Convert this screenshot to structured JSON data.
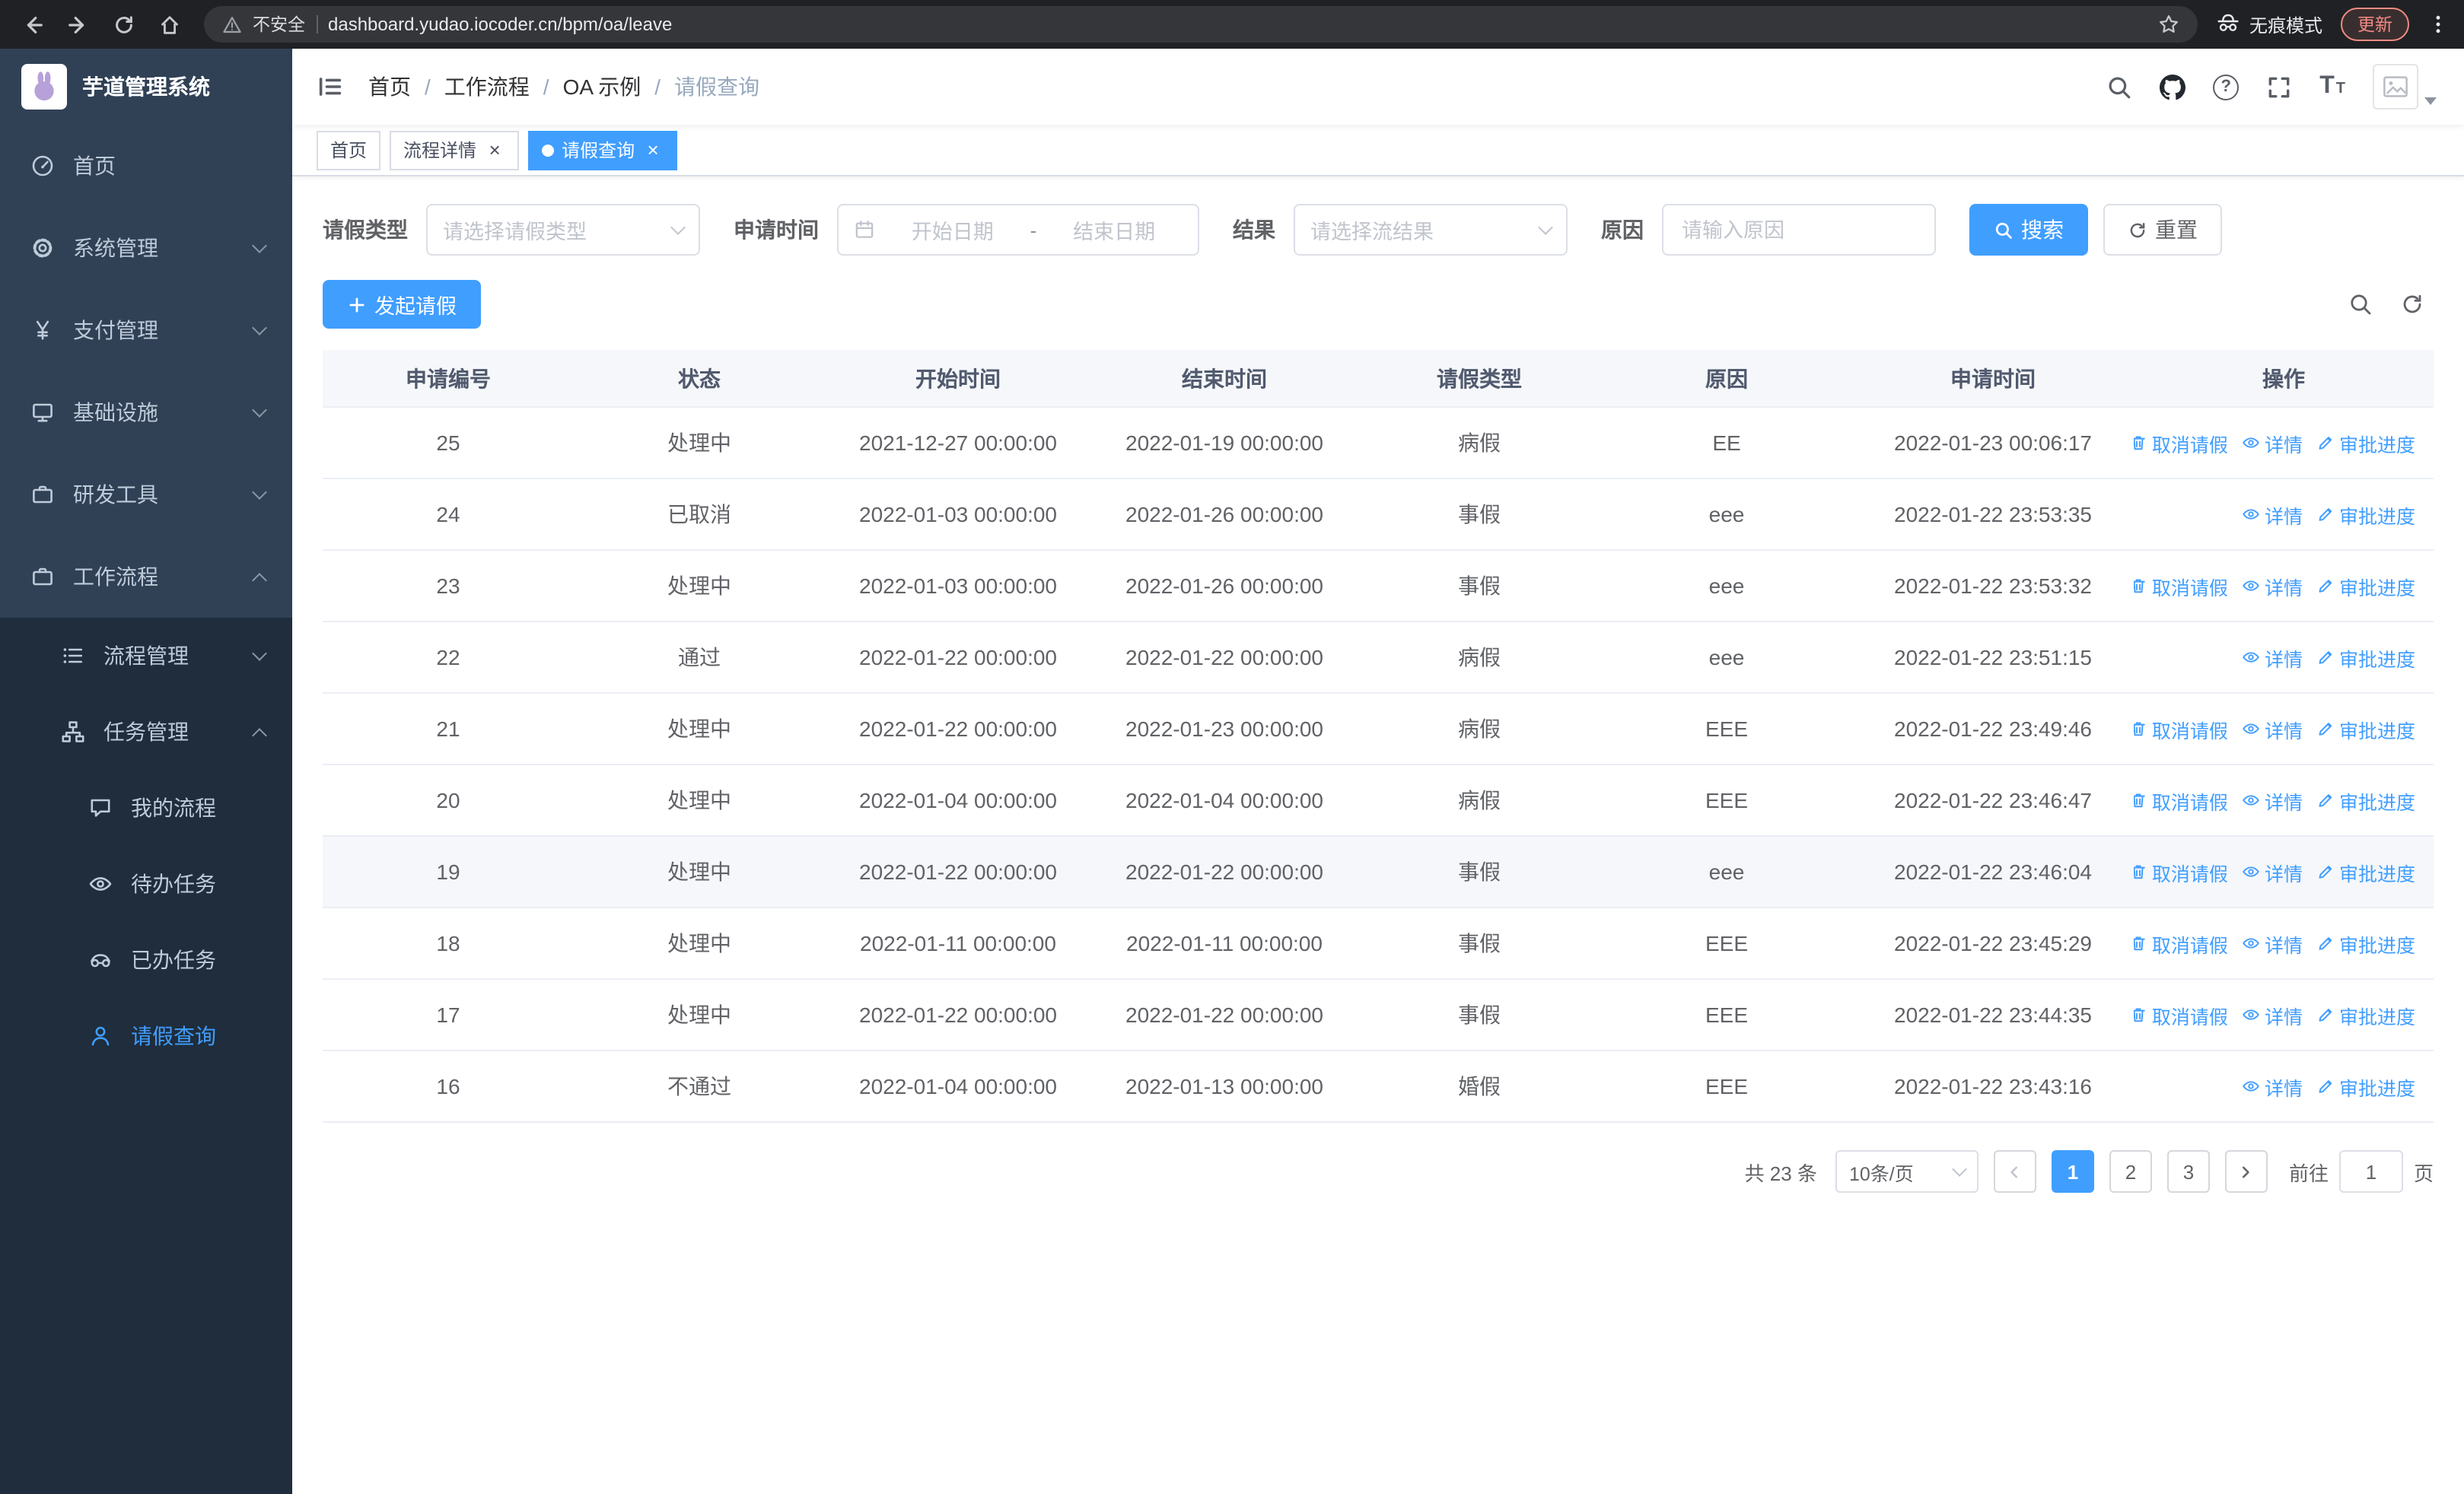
{
  "browser": {
    "security_label": "不安全",
    "url": "dashboard.yudao.iocoder.cn/bpm/oa/leave",
    "incognito_label": "无痕模式",
    "update_label": "更新"
  },
  "sidebar": {
    "app_title": "芋道管理系统",
    "items": [
      {
        "name": "home",
        "label": "首页",
        "icon": "gauge-icon",
        "level": 1
      },
      {
        "name": "system-management",
        "label": "系统管理",
        "icon": "gear-icon",
        "level": 1,
        "chevron": "down"
      },
      {
        "name": "payment-management",
        "label": "支付管理",
        "icon": "yen-icon",
        "level": 1,
        "chevron": "down"
      },
      {
        "name": "infrastructure",
        "label": "基础设施",
        "icon": "monitor-icon",
        "level": 1,
        "chevron": "down"
      },
      {
        "name": "dev-tools",
        "label": "研发工具",
        "icon": "briefcase-icon",
        "level": 1,
        "chevron": "down"
      },
      {
        "name": "workflow",
        "label": "工作流程",
        "icon": "briefcase-icon",
        "level": 1,
        "chevron": "up"
      },
      {
        "name": "process-management",
        "label": "流程管理",
        "icon": "list-icon",
        "level": 2,
        "chevron": "down"
      },
      {
        "name": "task-management",
        "label": "任务管理",
        "icon": "sitemap-icon",
        "level": 2,
        "chevron": "up"
      },
      {
        "name": "my-processes",
        "label": "我的流程",
        "icon": "chat-icon",
        "level": 3
      },
      {
        "name": "todo-tasks",
        "label": "待办任务",
        "icon": "eye-icon",
        "level": 3
      },
      {
        "name": "done-tasks",
        "label": "已办任务",
        "icon": "glasses-icon",
        "level": 3
      },
      {
        "name": "leave-query",
        "label": "请假查询",
        "icon": "user-icon",
        "level": 3,
        "active": true
      }
    ]
  },
  "navbar": {
    "breadcrumbs": [
      "首页",
      "工作流程",
      "OA 示例",
      "请假查询"
    ],
    "separator": "/"
  },
  "tags": [
    {
      "label": "首页",
      "closable": false,
      "active": false
    },
    {
      "label": "流程详情",
      "closable": true,
      "active": false
    },
    {
      "label": "请假查询",
      "closable": true,
      "active": true
    }
  ],
  "filters": {
    "leave_type_label": "请假类型",
    "leave_type_placeholder": "请选择请假类型",
    "apply_time_label": "申请时间",
    "start_placeholder": "开始日期",
    "range_separator": "-",
    "end_placeholder": "结束日期",
    "result_label": "结果",
    "result_placeholder": "请选择流结果",
    "reason_label": "原因",
    "reason_placeholder": "请输入原因",
    "search_label": "搜索",
    "reset_label": "重置"
  },
  "toolbar": {
    "create_label": "发起请假"
  },
  "table": {
    "columns": [
      "申请编号",
      "状态",
      "开始时间",
      "结束时间",
      "请假类型",
      "原因",
      "申请时间",
      "操作"
    ],
    "actions_meta": {
      "cancel": {
        "label": "取消请假",
        "icon": "trash-icon"
      },
      "detail": {
        "label": "详情",
        "icon": "eye-icon"
      },
      "progress": {
        "label": "审批进度",
        "icon": "edit-icon"
      }
    },
    "rows": [
      {
        "id": "25",
        "status": "处理中",
        "start": "2021-12-27 00:00:00",
        "end": "2022-01-19 00:00:00",
        "type": "病假",
        "reason": "EE",
        "applied": "2022-01-23 00:06:17",
        "actions": [
          "cancel",
          "detail",
          "progress"
        ]
      },
      {
        "id": "24",
        "status": "已取消",
        "start": "2022-01-03 00:00:00",
        "end": "2022-01-26 00:00:00",
        "type": "事假",
        "reason": "eee",
        "applied": "2022-01-22 23:53:35",
        "actions": [
          "detail",
          "progress"
        ]
      },
      {
        "id": "23",
        "status": "处理中",
        "start": "2022-01-03 00:00:00",
        "end": "2022-01-26 00:00:00",
        "type": "事假",
        "reason": "eee",
        "applied": "2022-01-22 23:53:32",
        "actions": [
          "cancel",
          "detail",
          "progress"
        ]
      },
      {
        "id": "22",
        "status": "通过",
        "start": "2022-01-22 00:00:00",
        "end": "2022-01-22 00:00:00",
        "type": "病假",
        "reason": "eee",
        "applied": "2022-01-22 23:51:15",
        "actions": [
          "detail",
          "progress"
        ]
      },
      {
        "id": "21",
        "status": "处理中",
        "start": "2022-01-22 00:00:00",
        "end": "2022-01-23 00:00:00",
        "type": "病假",
        "reason": "EEE",
        "applied": "2022-01-22 23:49:46",
        "actions": [
          "cancel",
          "detail",
          "progress"
        ]
      },
      {
        "id": "20",
        "status": "处理中",
        "start": "2022-01-04 00:00:00",
        "end": "2022-01-04 00:00:00",
        "type": "病假",
        "reason": "EEE",
        "applied": "2022-01-22 23:46:47",
        "actions": [
          "cancel",
          "detail",
          "progress"
        ]
      },
      {
        "id": "19",
        "status": "处理中",
        "start": "2022-01-22 00:00:00",
        "end": "2022-01-22 00:00:00",
        "type": "事假",
        "reason": "eee",
        "applied": "2022-01-22 23:46:04",
        "actions": [
          "cancel",
          "detail",
          "progress"
        ],
        "highlighted": true
      },
      {
        "id": "18",
        "status": "处理中",
        "start": "2022-01-11 00:00:00",
        "end": "2022-01-11 00:00:00",
        "type": "事假",
        "reason": "EEE",
        "applied": "2022-01-22 23:45:29",
        "actions": [
          "cancel",
          "detail",
          "progress"
        ]
      },
      {
        "id": "17",
        "status": "处理中",
        "start": "2022-01-22 00:00:00",
        "end": "2022-01-22 00:00:00",
        "type": "事假",
        "reason": "EEE",
        "applied": "2022-01-22 23:44:35",
        "actions": [
          "cancel",
          "detail",
          "progress"
        ]
      },
      {
        "id": "16",
        "status": "不通过",
        "start": "2022-01-04 00:00:00",
        "end": "2022-01-13 00:00:00",
        "type": "婚假",
        "reason": "EEE",
        "applied": "2022-01-22 23:43:16",
        "actions": [
          "detail",
          "progress"
        ]
      }
    ]
  },
  "pagination": {
    "total_label": "共 23 条",
    "page_size_label": "10条/页",
    "pages": [
      "1",
      "2",
      "3"
    ],
    "active_page": "1",
    "goto_label": "前往",
    "goto_value": "1",
    "goto_unit": "页"
  }
}
